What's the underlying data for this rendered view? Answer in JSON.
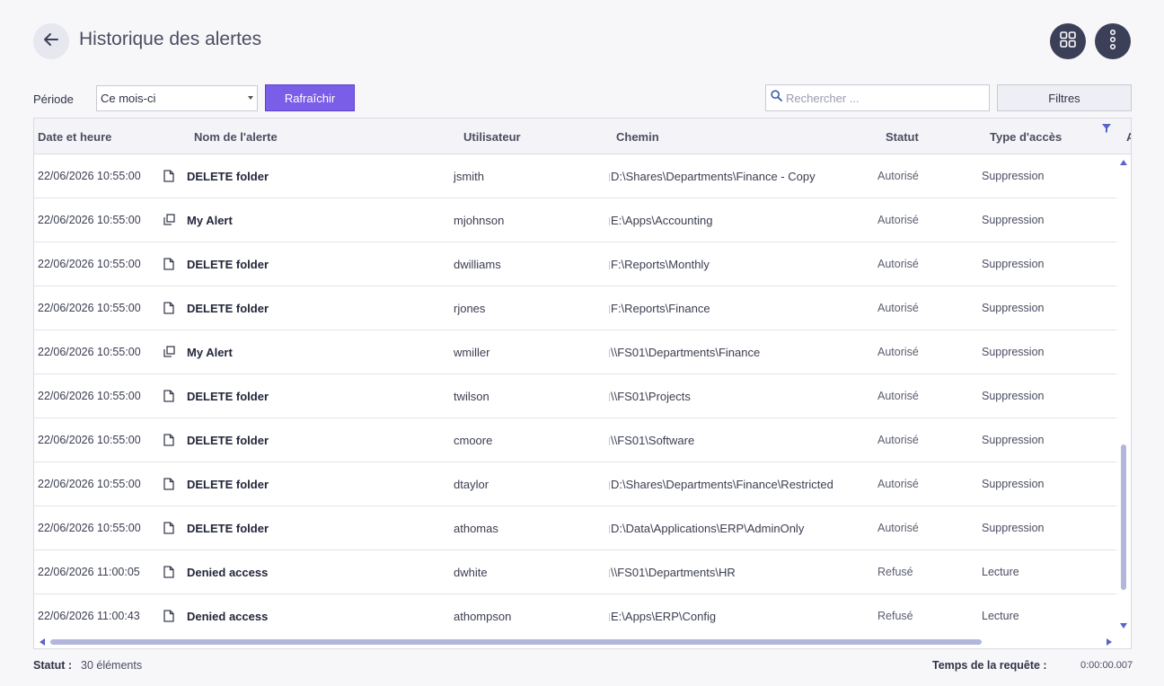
{
  "header": {
    "title": "Historique des alertes",
    "back_icon": "arrow-left-icon",
    "grid_view_icon": "grid-icon",
    "more_icon": "more-vertical-icon"
  },
  "toolbar": {
    "period_label": "Période",
    "period_value": "Ce mois-ci",
    "refresh_label": "Rafraîchir",
    "search_placeholder": "Rechercher ...",
    "filters_label": "Filtres"
  },
  "table": {
    "columns": [
      "Date et heure",
      "Nom de l'alerte",
      "Utilisateur",
      "Chemin",
      "Statut",
      "Type d'accès",
      "A"
    ],
    "rows": [
      {
        "date": "22/06/2026 10:55:00",
        "icon": "file-icon",
        "name": "DELETE folder",
        "user": "jsmith",
        "path": "D:\\Shares\\Departments\\Finance - Copy",
        "status": "Autorisé",
        "access": "Suppression"
      },
      {
        "date": "22/06/2026 10:55:00",
        "icon": "copy-icon",
        "name": "My Alert",
        "user": "mjohnson",
        "path": "E:\\Apps\\Accounting",
        "status": "Autorisé",
        "access": "Suppression"
      },
      {
        "date": "22/06/2026 10:55:00",
        "icon": "file-icon",
        "name": "DELETE folder",
        "user": "dwilliams",
        "path": "F:\\Reports\\Monthly",
        "status": "Autorisé",
        "access": "Suppression"
      },
      {
        "date": "22/06/2026 10:55:00",
        "icon": "file-icon",
        "name": "DELETE folder",
        "user": "rjones",
        "path": "F:\\Reports\\Finance",
        "status": "Autorisé",
        "access": "Suppression"
      },
      {
        "date": "22/06/2026 10:55:00",
        "icon": "copy-icon",
        "name": "My Alert",
        "user": "wmiller",
        "path": "\\\\FS01\\Departments\\Finance",
        "status": "Autorisé",
        "access": "Suppression"
      },
      {
        "date": "22/06/2026 10:55:00",
        "icon": "file-icon",
        "name": "DELETE folder",
        "user": "twilson",
        "path": "\\\\FS01\\Projects",
        "status": "Autorisé",
        "access": "Suppression"
      },
      {
        "date": "22/06/2026 10:55:00",
        "icon": "file-icon",
        "name": "DELETE folder",
        "user": "cmoore",
        "path": "\\\\FS01\\Software",
        "status": "Autorisé",
        "access": "Suppression"
      },
      {
        "date": "22/06/2026 10:55:00",
        "icon": "file-icon",
        "name": "DELETE folder",
        "user": "dtaylor",
        "path": "D:\\Shares\\Departments\\Finance\\Restricted",
        "status": "Autorisé",
        "access": "Suppression"
      },
      {
        "date": "22/06/2026 10:55:00",
        "icon": "file-icon",
        "name": "DELETE folder",
        "user": "athomas",
        "path": "D:\\Data\\Applications\\ERP\\AdminOnly",
        "status": "Autorisé",
        "access": "Suppression"
      },
      {
        "date": "22/06/2026 11:00:05",
        "icon": "file-icon",
        "name": "Denied access",
        "user": "dwhite",
        "path": "\\\\FS01\\Departments\\HR",
        "status": "Refusé",
        "access": "Lecture"
      },
      {
        "date": "22/06/2026 11:00:43",
        "icon": "file-icon",
        "name": "Denied access",
        "user": "athompson",
        "path": "E:\\Apps\\ERP\\Config",
        "status": "Refusé",
        "access": "Lecture"
      }
    ]
  },
  "footer": {
    "status_label": "Statut :",
    "status_value": "30 éléments",
    "time_label": "Temps de la requête :",
    "time_value": "0:00:00.007"
  },
  "colors": {
    "accent": "#7b5ee8",
    "dark_button": "#3b3f58",
    "scroll_thumb": "#b3b6dc"
  }
}
